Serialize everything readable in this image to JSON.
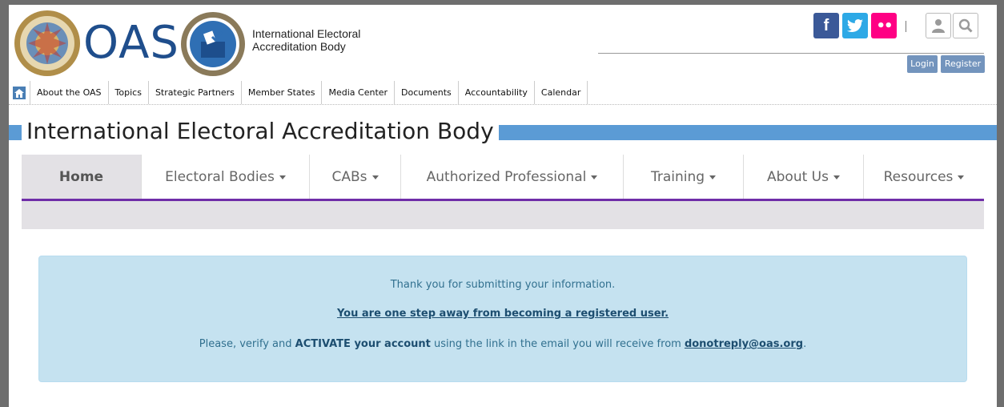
{
  "header": {
    "logo_text": "OAS",
    "site_title_line1": "International Electoral",
    "site_title_line2": "Accreditation Body",
    "social": {
      "facebook": "f",
      "twitter": "t",
      "flickr": "••"
    },
    "login_label": "Login",
    "register_label": "Register"
  },
  "topnav": {
    "items": [
      "About the OAS",
      "Topics",
      "Strategic Partners",
      "Member States",
      "Media Center",
      "Documents",
      "Accountability",
      "Calendar"
    ]
  },
  "band": {
    "title": "International Electoral Accreditation Body"
  },
  "mainnav": {
    "items": [
      {
        "label": "Home",
        "active": true
      },
      {
        "label": "Electoral Bodies"
      },
      {
        "label": "CABs"
      },
      {
        "label": "Authorized Professional"
      },
      {
        "label": "Training"
      },
      {
        "label": "About Us"
      },
      {
        "label": "Resources"
      }
    ]
  },
  "alert": {
    "line1": "Thank you for submitting your information.",
    "line2": "You are one step away from becoming a registered user. ",
    "line3_pre": "Please, verify and ",
    "line3_bold": "ACTIVATE your account",
    "line3_mid": " using the link in the email you will receive from ",
    "line3_email": "donotreply@oas.org",
    "line3_end": "."
  },
  "colors": {
    "frame": "#6e6e6e",
    "band": "#5b9bd5",
    "nav_underline": "#6f2da8",
    "alert_bg": "#c5e2f0",
    "button": "#7394bd"
  }
}
